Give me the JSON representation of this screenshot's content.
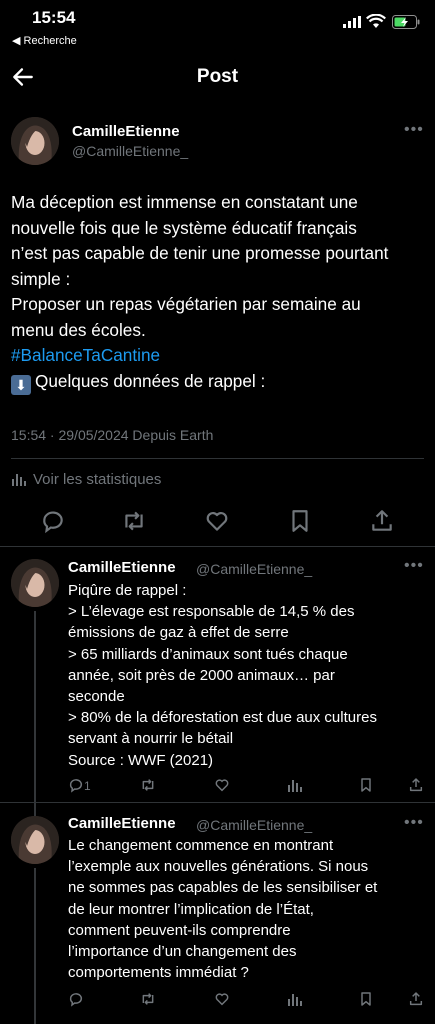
{
  "status": {
    "time": "15:54",
    "back_label": "◀ Recherche"
  },
  "header": {
    "title": "Post"
  },
  "post": {
    "name": "CamilleEtienne",
    "handle": "@CamilleEtienne_",
    "lines": [
      "Ma déception est immense en constatant  une",
      "nouvelle fois que le système éducatif français",
      "n’est pas capable de tenir une promesse pourtant",
      "simple :",
      "Proposer un repas végétarien par semaine au",
      "menu des écoles."
    ],
    "hashtag": "#BalanceTaCantine",
    "last_line": "Quelques données de rappel :",
    "arrow_emoji": "⬇",
    "meta": "15:54 · 29/05/2024 Depuis Earth",
    "stats_label": "Voir les statistiques"
  },
  "replies": [
    {
      "name": "CamilleEtienne",
      "handle": "@CamilleEtienne_",
      "lines": [
        "Piqûre de rappel :",
        "> L’élevage est responsable de 14,5 % des",
        "émissions de gaz à effet de serre",
        "> 65 milliards d’animaux sont tués chaque",
        "année, soit près de 2000 animaux… par",
        "seconde",
        "> 80% de la déforestation est due aux cultures",
        "servant à nourrir le bétail",
        "Source : WWF (2021)"
      ],
      "reply_count": "1"
    },
    {
      "name": "CamilleEtienne",
      "handle": "@CamilleEtienne_",
      "lines": [
        "Le changement commence en montrant",
        "l’exemple aux nouvelles générations. Si nous",
        "ne sommes pas capables de les sensibiliser et",
        "de leur montrer l’implication de l’État,",
        "comment peuvent-ils comprendre",
        "l’importance d’un changement des",
        "comportements immédiat ?"
      ],
      "reply_count": ""
    }
  ],
  "colors": {
    "background": "#000000",
    "text": "#e7e9ea",
    "muted": "#71767b",
    "link": "#1d9bf0",
    "battery": "#4cd964"
  }
}
